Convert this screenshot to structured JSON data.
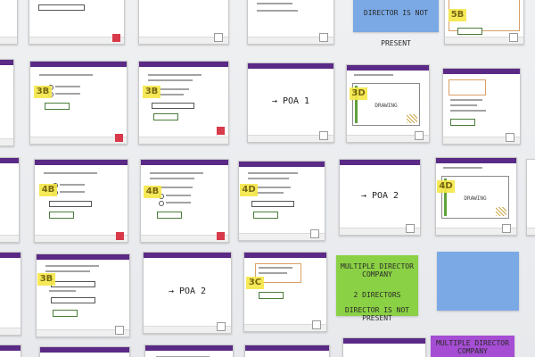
{
  "cards": {
    "director_for_you": {
      "tag": "3B",
      "heading": "WHICH DIRECTOR ARE YOU?"
    },
    "also_want_to": {
      "tag": "3B"
    },
    "poa1": {
      "label": "→ POA 1"
    },
    "add_signature_1": {
      "tag": "3D",
      "heading": "ADD YOUR SIGNATURE",
      "box_label": "DRAWING"
    },
    "director_for_you_2": {
      "tag": "4B",
      "heading": "WHICH DIRECTOR ARE YOU?"
    },
    "who_is_applying": {
      "tag": "4B"
    },
    "other_director": {
      "tag": "4D"
    },
    "poa2_a": {
      "label": "→ POA 2"
    },
    "add_signature_2": {
      "tag": "4D",
      "heading": "ADD YOUR SIGNATURE",
      "box_label": "DRAWING"
    },
    "all_directors": {
      "tag": "3B",
      "heading": "WHAT ARE THE DIRECTORS EMAIL ADDRESSES?"
    },
    "poa2_b": {
      "label": "→ POA 2"
    },
    "other_directors_3c": {
      "tag": "3C"
    },
    "top_right_card": {
      "tag": "5B"
    }
  },
  "notes": {
    "director_not_present": "DIRECTOR IS NOT PRESENT",
    "multiple_director_company": "MULTIPLE DIRECTOR COMPANY",
    "two_directors": "2 DIRECTORS",
    "director_present": "DIRECTOR IS NOT PRESENT",
    "multiple_director_company_bottom": "MULTIPLE DIRECTOR COMPANY"
  },
  "colors": {
    "card_bar": "#5a2a86",
    "sticky_yellow": "#f6e84a",
    "note_blue": "#7aa9e6",
    "note_green": "#8bd145",
    "note_purple": "#a54dd3"
  }
}
